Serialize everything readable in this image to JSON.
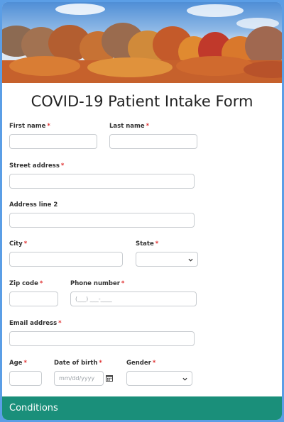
{
  "form": {
    "title": "COVID-19 Patient Intake Form",
    "required_mark": "*",
    "fields": {
      "first_name": {
        "label": "First name",
        "value": ""
      },
      "last_name": {
        "label": "Last name",
        "value": ""
      },
      "street_address": {
        "label": "Street address",
        "value": ""
      },
      "address_line_2": {
        "label": "Address line 2",
        "value": ""
      },
      "city": {
        "label": "City",
        "value": ""
      },
      "state": {
        "label": "State",
        "selected": ""
      },
      "zip_code": {
        "label": "Zip code",
        "value": ""
      },
      "phone_number": {
        "label": "Phone number",
        "placeholder": "(___) ___-____"
      },
      "email_address": {
        "label": "Email address",
        "value": ""
      },
      "age": {
        "label": "Age",
        "value": ""
      },
      "date_of_birth": {
        "label": "Date of birth",
        "placeholder": "mm/dd/yyyy"
      },
      "gender": {
        "label": "Gender",
        "selected": ""
      }
    },
    "sections": {
      "conditions": "Conditions"
    }
  },
  "colors": {
    "page_background": "#5b9ee6",
    "required": "#e03030",
    "section_header": "#1a8f7a"
  },
  "icons": {
    "date_picker": "calendar-icon",
    "select_caret": "chevron-down-icon"
  }
}
